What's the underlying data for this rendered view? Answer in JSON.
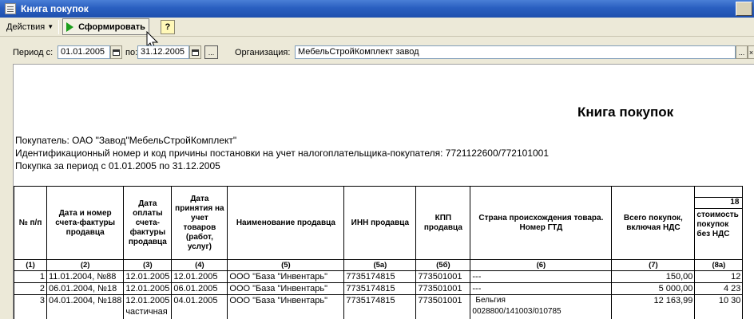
{
  "window": {
    "title": "Книга покупок"
  },
  "toolbar": {
    "actions_label": "Действия",
    "form_label": "Сформировать",
    "help_label": "?"
  },
  "filters": {
    "period_from_label": "Период с:",
    "period_from_value": "01.01.2005",
    "period_to_label": "по:",
    "period_to_value": "31.12.2005",
    "org_label": "Организация:",
    "org_value": "МебельСтройКомплект завод",
    "picker_dots": "...",
    "clear_x": "×"
  },
  "report": {
    "title": "Книга покупок",
    "buyer_line": "Покупатель:  ОАО \"Завод\"МебельСтройКомплект\"",
    "inn_line": "Идентификационный номер и код причины постановки на учет налогоплательщика-покупателя:  7721122600/772101001",
    "period_line": "Покупка за период с 01.01.2005 по 31.12.2005",
    "columns": [
      {
        "head": "№ п/п",
        "num": "(1)"
      },
      {
        "head": "Дата и номер счета-фактуры продавца",
        "num": "(2)"
      },
      {
        "head": "Дата оплаты счета-фактуры продавца",
        "num": "(3)"
      },
      {
        "head": "Дата принятия на учет товаров (работ, услуг)",
        "num": "(4)"
      },
      {
        "head": "Наименование продавца",
        "num": "(5)"
      },
      {
        "head": "ИНН продавца",
        "num": "(5а)"
      },
      {
        "head": "КПП продавца",
        "num": "(5б)"
      },
      {
        "head": "Страна происхождения товара. Номер ГТД",
        "num": "(6)"
      },
      {
        "head": "Всего покупок, включая НДС",
        "num": "(7)"
      },
      {
        "head_top": "18",
        "head": "стоимость покупок без НДС",
        "num": "(8а)"
      }
    ],
    "rows": [
      {
        "n": "1",
        "invoice": "11.01.2004, №88",
        "paid": "12.01.2005",
        "accepted": "12.01.2005",
        "seller": "ООО \"База \"Инвентарь\"",
        "inn": "7735174815",
        "kpp": "773501001",
        "country": "---",
        "country2": "",
        "total": "150,00",
        "net": "12",
        "paid2": ""
      },
      {
        "n": "2",
        "invoice": "06.01.2004, №18",
        "paid": "12.01.2005",
        "accepted": "06.01.2005",
        "seller": "ООО \"База \"Инвентарь\"",
        "inn": "7735174815",
        "kpp": "773501001",
        "country": "---",
        "country2": "",
        "total": "5 000,00",
        "net": "4 23",
        "paid2": ""
      },
      {
        "n": "3",
        "invoice": "04.01.2004, №188",
        "paid": "12.01.2005",
        "accepted": "04.01.2005",
        "seller": "ООО \"База \"Инвентарь\"",
        "inn": "7735174815",
        "kpp": "773501001",
        "country": "Бельгия",
        "country2": "0028800/141003/010785",
        "total": "12 163,99",
        "net": "10 30",
        "paid2": "частичная"
      }
    ]
  }
}
